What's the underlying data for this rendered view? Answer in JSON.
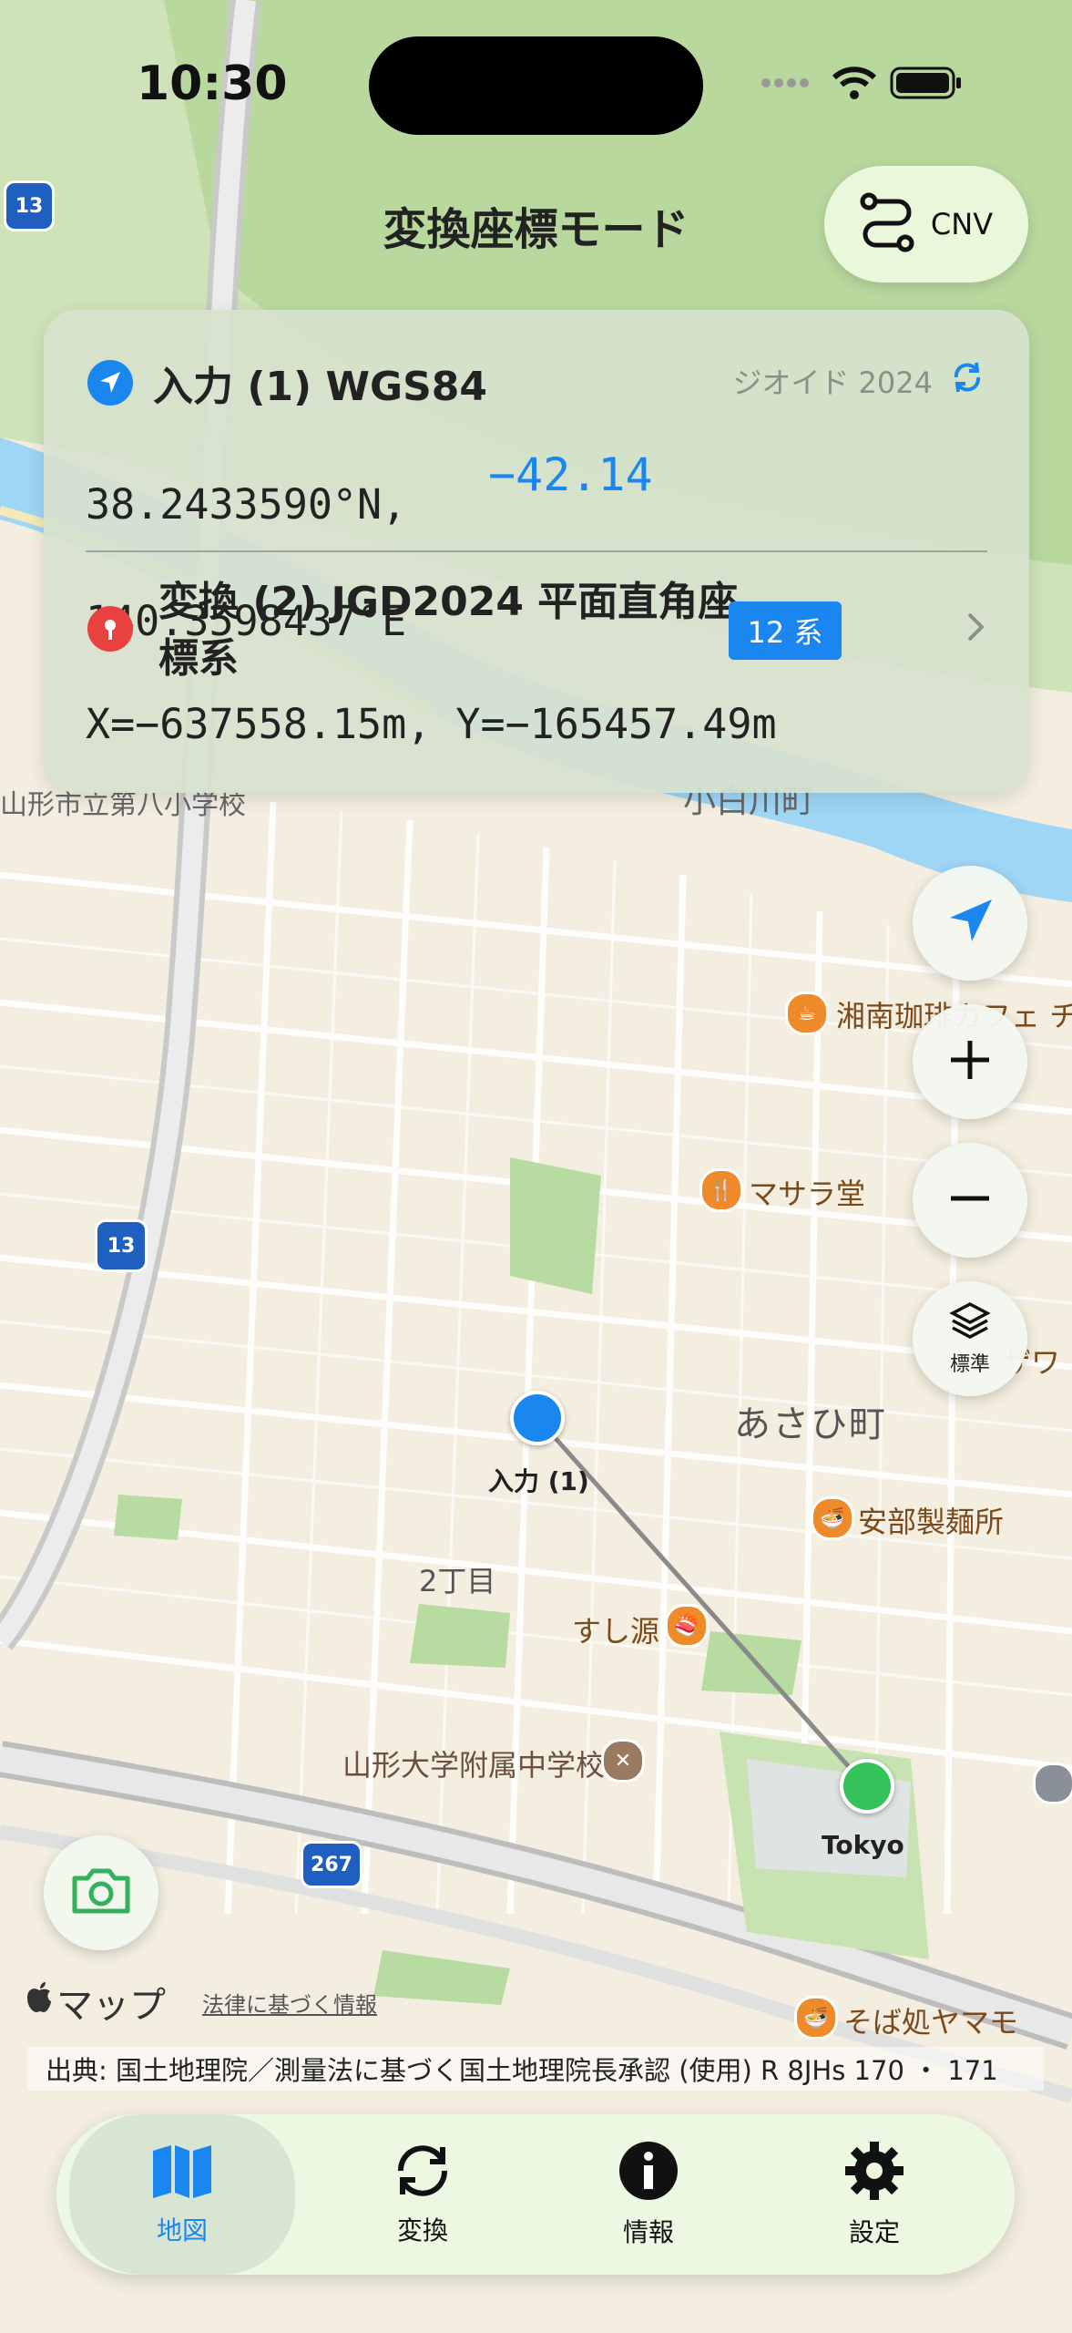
{
  "status_bar": {
    "time": "10:30"
  },
  "header": {
    "title": "変換座標モード",
    "cnv_label": "CNV"
  },
  "input_panel": {
    "heading": "入力 (1) WGS84",
    "geoid_label": "ジオイド 2024",
    "latitude": "38.2433590°N,",
    "longitude": "140.3598437°E",
    "height": "−42.14"
  },
  "output_panel": {
    "heading": "変換 (2) JGD2024 平面直角座標系",
    "zone_badge": "12 系",
    "xy": "X=−637558.15m, Y=−165457.49m"
  },
  "map": {
    "labels": {
      "cafe": "湘南珈琲カフェ チ",
      "masara": "マサラ堂",
      "abe": "安部製麺所",
      "sushi": "すし源",
      "school": "山形大学附属中学校",
      "soba": "そば処ヤマモ",
      "asahi": "あさひ町",
      "chome": "2丁目",
      "top_left": "山形市立第八小学校",
      "top_mid": "小白川町",
      "right_edge": "ザワ"
    },
    "route_shields": [
      "13",
      "13",
      "267"
    ],
    "pin_input_label": "入力 (1)",
    "pin_output_label": "Tokyo",
    "layer_label": "標準",
    "maps_brand": "マップ",
    "legal_link": "法律に基づく情報",
    "attribution": "出典: 国土地理院／測量法に基づく国土地理院長承認 (使用) R 8JHs 170 ・ 171"
  },
  "tabs": [
    {
      "label": "地図",
      "icon": "map-icon",
      "active": true
    },
    {
      "label": "変換",
      "icon": "sync-icon",
      "active": false
    },
    {
      "label": "情報",
      "icon": "info-icon",
      "active": false
    },
    {
      "label": "設定",
      "icon": "gear-icon",
      "active": false
    }
  ],
  "colors": {
    "accent": "#1a86f0",
    "input_pin": "#1a86f0",
    "output_pin": "#33c15a",
    "water": "#9fd6f5"
  }
}
